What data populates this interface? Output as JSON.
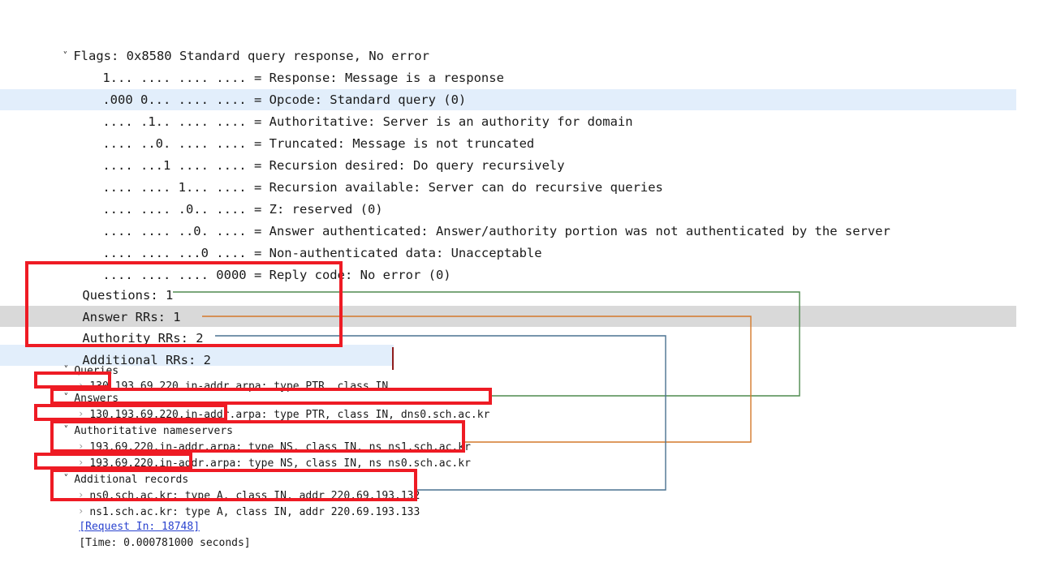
{
  "packet_detail": {
    "flags_header": {
      "chevron": "chevron-down",
      "text": "Flags: 0x8580 Standard query response, No error"
    },
    "flag_bits": [
      {
        "bits": "1... .... .... ....",
        "sep": "=",
        "text": "Response: Message is a response",
        "highlight": "none"
      },
      {
        "bits": ".000 0... .... ....",
        "sep": "=",
        "text": "Opcode: Standard query (0)",
        "highlight": "none"
      },
      {
        "bits": ".... .1.. .... ....",
        "sep": "=",
        "text": "Authoritative: Server is an authority for domain",
        "highlight": "blue"
      },
      {
        "bits": ".... ..0. .... ....",
        "sep": "=",
        "text": "Truncated: Message is not truncated",
        "highlight": "none"
      },
      {
        "bits": ".... ...1 .... ....",
        "sep": "=",
        "text": "Recursion desired: Do query recursively",
        "highlight": "none"
      },
      {
        "bits": ".... .... 1... ....",
        "sep": "=",
        "text": "Recursion available: Server can do recursive queries",
        "highlight": "none"
      },
      {
        "bits": ".... .... .0.. ....",
        "sep": "=",
        "text": "Z: reserved (0)",
        "highlight": "none"
      },
      {
        "bits": ".... .... ..0. ....",
        "sep": "=",
        "text": "Answer authenticated: Answer/authority portion was not authenticated by the server",
        "highlight": "none"
      },
      {
        "bits": ".... .... ...0 ....",
        "sep": "=",
        "text": "Non-authenticated data: Unacceptable",
        "highlight": "none"
      },
      {
        "bits": ".... .... .... 0000",
        "sep": "=",
        "text": "Reply code: No error (0)",
        "highlight": "none"
      }
    ],
    "counts": [
      {
        "label": "Questions: 1",
        "highlight": "none"
      },
      {
        "label": "Answer RRs: 1",
        "highlight": "none"
      },
      {
        "label": "Authority RRs: 2",
        "highlight": "gray"
      },
      {
        "label": "Additional RRs: 2",
        "highlight": "none"
      }
    ],
    "sections": [
      {
        "chevron": "chevron-down",
        "title": "Queries",
        "highlight": "blue",
        "records": [
          {
            "chevron": "chevron-right",
            "text": "130.193.69.220.in-addr.arpa: type PTR, class IN"
          }
        ]
      },
      {
        "chevron": "chevron-down",
        "title": "Answers",
        "highlight": "none",
        "records": [
          {
            "chevron": "chevron-right",
            "text": "130.193.69.220.in-addr.arpa: type PTR, class IN, dns0.sch.ac.kr"
          }
        ]
      },
      {
        "chevron": "chevron-down",
        "title": "Authoritative nameservers",
        "highlight": "none",
        "records": [
          {
            "chevron": "chevron-right",
            "text": "193.69.220.in-addr.arpa: type NS, class IN, ns ns1.sch.ac.kr"
          },
          {
            "chevron": "chevron-right",
            "text": "193.69.220.in-addr.arpa: type NS, class IN, ns ns0.sch.ac.kr"
          }
        ]
      },
      {
        "chevron": "chevron-down",
        "title": "Additional records",
        "highlight": "none",
        "records": [
          {
            "chevron": "chevron-right",
            "text": "ns0.sch.ac.kr: type A, class IN, addr 220.69.193.132"
          },
          {
            "chevron": "chevron-right",
            "text": "ns1.sch.ac.kr: type A, class IN, addr 220.69.193.133"
          }
        ]
      }
    ],
    "footer": [
      {
        "text": "[Request In: 18748]",
        "style": "link"
      },
      {
        "text": "[Time: 0.000781000 seconds]",
        "style": "plain"
      }
    ]
  },
  "annotations": {
    "box_color": "#ee1b24",
    "connector_colors": {
      "answers": "#4e8a4e",
      "authority": "#d4792a",
      "additional": "#4a7290"
    },
    "connector_labels": [
      {
        "name": "answer-rrs-to-answers",
        "from": "Answer RRs: 1",
        "to": "Answers record",
        "color": "#4e8a4e"
      },
      {
        "name": "authority-rrs-to-nameservers",
        "from": "Authority RRs: 2",
        "to": "Authoritative nameservers records",
        "color": "#d4792a"
      },
      {
        "name": "additional-rrs-to-records",
        "from": "Additional RRs: 2",
        "to": "Additional records",
        "color": "#4a7290"
      }
    ]
  }
}
